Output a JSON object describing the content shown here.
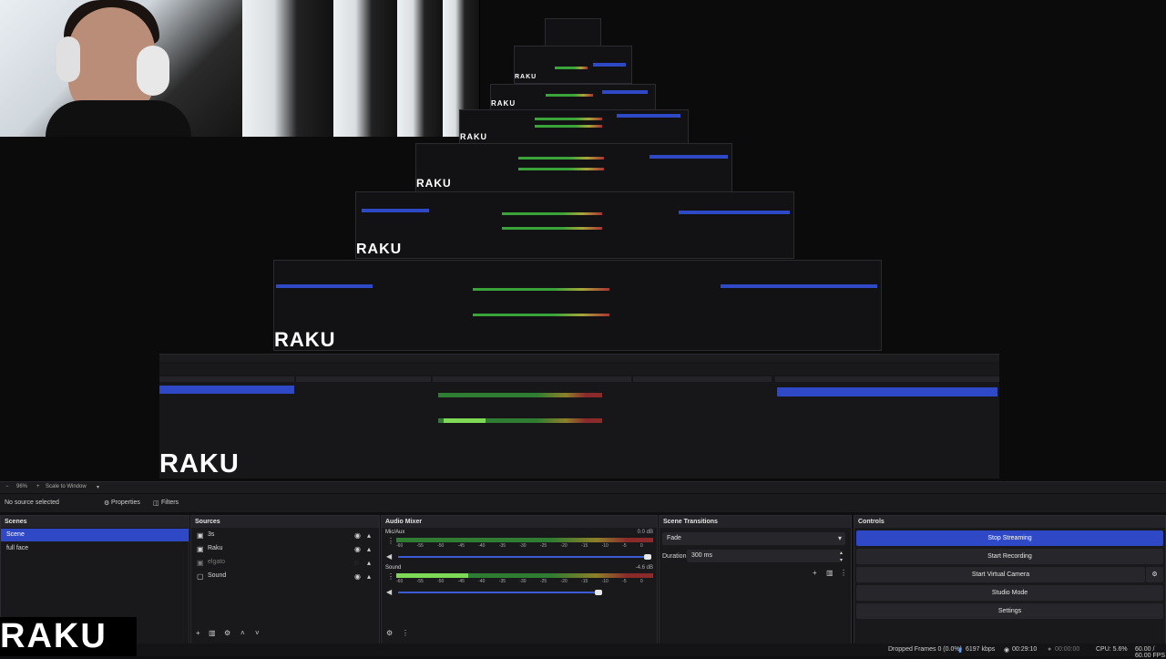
{
  "logo": "RAKU",
  "zoom": {
    "level": "96%",
    "mode": "Scale to Window"
  },
  "properties_bar": {
    "selection": "No source selected",
    "properties_label": "Properties",
    "filters_label": "Filters"
  },
  "scenes": {
    "title": "Scenes",
    "items": [
      {
        "label": "Scene",
        "selected": true
      },
      {
        "label": "full face",
        "selected": false
      }
    ]
  },
  "sources": {
    "title": "Sources",
    "items": [
      {
        "label": "3s"
      },
      {
        "label": "Raku"
      },
      {
        "label": "elgato"
      },
      {
        "label": "Sound"
      }
    ]
  },
  "audio_mixer": {
    "title": "Audio Mixer",
    "channels": [
      {
        "name": "Mic/Aux",
        "db": "0.0 dB",
        "level": 0.0
      },
      {
        "name": "Sound",
        "db": "-4.6 dB",
        "level": 0.28
      }
    ],
    "ticks": [
      "-60",
      "-55",
      "-50",
      "-45",
      "-40",
      "-35",
      "-30",
      "-25",
      "-20",
      "-15",
      "-10",
      "-5",
      "0"
    ]
  },
  "scene_transitions": {
    "title": "Scene Transitions",
    "transition": "Fade",
    "duration_label": "Duration",
    "duration_value": "300 ms"
  },
  "controls": {
    "title": "Controls",
    "buttons": [
      "Stop Streaming",
      "Start Recording",
      "Start Virtual Camera",
      "Studio Mode",
      "Settings"
    ]
  },
  "status": {
    "dropped_frames": "Dropped Frames 0 (0.0%)",
    "bitrate": "6197 kbps",
    "stream_time": "00:29:10",
    "rec_time": "00:00:00",
    "cpu": "CPU: 5.6%",
    "fps": "60.00 / 60.00 FPS"
  },
  "colors": {
    "accent": "#2f48c6",
    "panel": "#19191c",
    "header": "#232328"
  }
}
